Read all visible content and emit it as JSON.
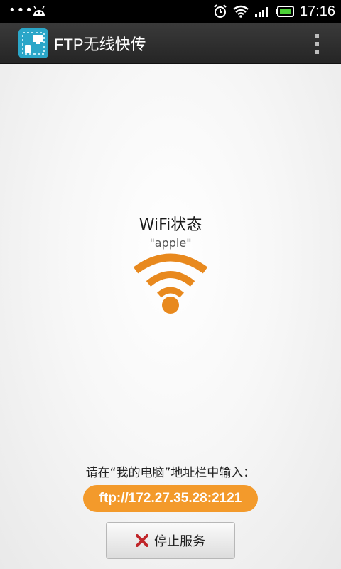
{
  "status_bar": {
    "time": "17:16",
    "icons": [
      "notification-dots-icon",
      "android-icon",
      "alarm-icon",
      "wifi-signal-icon",
      "cell-signal-icon",
      "battery-icon"
    ]
  },
  "action_bar": {
    "title": "FTP无线快传",
    "app_icon": "ftp-app-icon",
    "menu_icon": "overflow-menu-icon"
  },
  "wifi": {
    "title": "WiFi状态",
    "ssid": "\"apple\"",
    "icon": "wifi-icon",
    "color": "#e8891e"
  },
  "instructions": {
    "text": "请在“我的电脑”地址栏中输入：",
    "address": "ftp://172.27.35.28:2121",
    "address_color": "#f39a2b"
  },
  "stop_button": {
    "label": "停止服务",
    "icon": "close-x-icon",
    "icon_color": "#c0262a"
  }
}
